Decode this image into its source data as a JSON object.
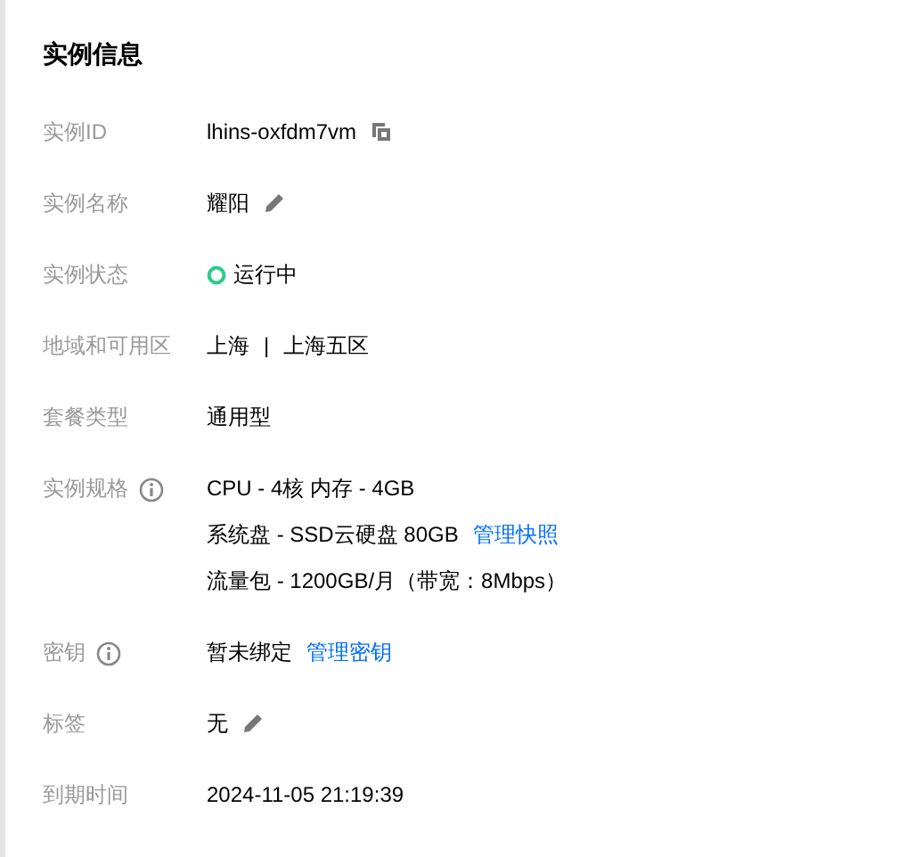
{
  "title": "实例信息",
  "rows": [
    {
      "label": "实例ID",
      "info": false,
      "lines": [
        [
          {
            "kind": "text",
            "text": "lhins-oxfdm7vm"
          },
          {
            "kind": "copy"
          }
        ]
      ]
    },
    {
      "label": "实例名称",
      "info": false,
      "lines": [
        [
          {
            "kind": "text",
            "text": "耀阳"
          },
          {
            "kind": "edit"
          }
        ]
      ]
    },
    {
      "label": "实例状态",
      "info": false,
      "lines": [
        [
          {
            "kind": "status"
          },
          {
            "kind": "text",
            "text": "运行中"
          }
        ]
      ]
    },
    {
      "label": "地域和可用区",
      "info": false,
      "lines": [
        [
          {
            "kind": "text",
            "text": "上海"
          },
          {
            "kind": "text",
            "text": "|"
          },
          {
            "kind": "text",
            "text": "上海五区"
          }
        ]
      ]
    },
    {
      "label": "套餐类型",
      "info": false,
      "lines": [
        [
          {
            "kind": "text",
            "text": "通用型"
          }
        ]
      ]
    },
    {
      "label": "实例规格",
      "info": true,
      "lines": [
        [
          {
            "kind": "text",
            "text": "CPU - 4核 内存 - 4GB"
          }
        ],
        [
          {
            "kind": "text",
            "text": "系统盘 - SSD云硬盘 80GB"
          },
          {
            "kind": "link",
            "text": "管理快照"
          }
        ],
        [
          {
            "kind": "text",
            "text": "流量包 - 1200GB/月（带宽：8Mbps）"
          }
        ]
      ]
    },
    {
      "label": "密钥",
      "info": true,
      "lines": [
        [
          {
            "kind": "text",
            "text": "暂未绑定"
          },
          {
            "kind": "link",
            "text": "管理密钥"
          }
        ]
      ]
    },
    {
      "label": "标签",
      "info": false,
      "lines": [
        [
          {
            "kind": "text",
            "text": "无"
          },
          {
            "kind": "edit"
          }
        ]
      ]
    },
    {
      "label": "到期时间",
      "info": false,
      "lines": [
        [
          {
            "kind": "text",
            "text": "2024-11-05 21:19:39"
          }
        ]
      ]
    }
  ]
}
